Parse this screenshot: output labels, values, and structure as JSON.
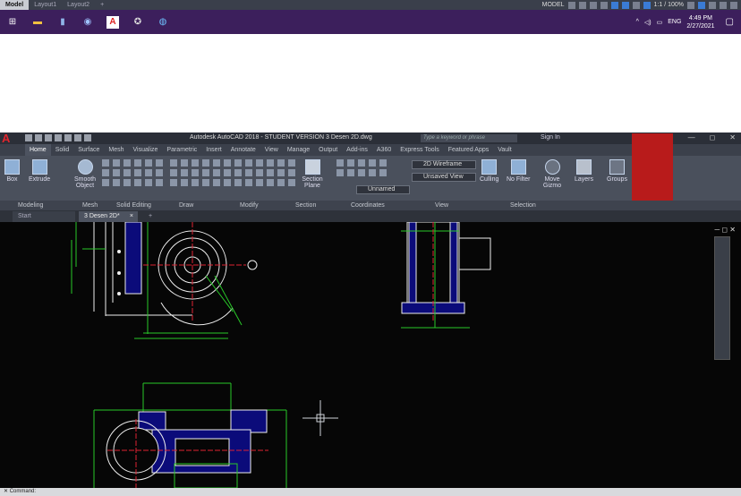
{
  "top_strip": {
    "layout_tabs": [
      "Model",
      "Layout1",
      "Layout2"
    ],
    "add_tab": "+",
    "model_label": "MODEL",
    "scale": "1:1 / 100%"
  },
  "taskbar": {
    "icons": [
      "windows-start-icon",
      "file-explorer-icon",
      "notepad-icon",
      "browser-icon",
      "autocad-icon",
      "app-icon",
      "globe-icon"
    ],
    "language": "ENG",
    "time": "4:49 PM",
    "date": "2/27/2021"
  },
  "window": {
    "app_logo": "A",
    "title": "Autodesk AutoCAD 2018 - STUDENT VERSION    3 Desen 2D.dwg",
    "search_placeholder": "Type a keyword or phrase",
    "sign_in": "Sign In",
    "minimize": "—",
    "restore": "◻",
    "close": "✕"
  },
  "ribbon_tabs": [
    "Home",
    "Solid",
    "Surface",
    "Mesh",
    "Visualize",
    "Parametric",
    "Insert",
    "Annotate",
    "View",
    "Manage",
    "Output",
    "Add-ins",
    "A360",
    "Express Tools",
    "Featured Apps",
    "Vault"
  ],
  "ribbon": {
    "box": "Box",
    "extrude": "Extrude",
    "smooth_object": "Smooth Object",
    "section_plane": "Section Plane",
    "visual_style": "2D Wireframe",
    "view_preset": "Unsaved View",
    "ucs_name": "Unnamed",
    "culling": "Culling",
    "no_filter": "No Filter",
    "move_gizmo": "Move Gizmo",
    "layers": "Layers",
    "groups": "Groups"
  },
  "panel_labels": [
    "Modeling",
    "Mesh",
    "Solid Editing",
    "Draw",
    "Modify",
    "Section",
    "Coordinates",
    "View",
    "Selection"
  ],
  "file_tabs": {
    "start": "Start",
    "active": "3 Desen 2D*",
    "close": "×",
    "add": "+"
  },
  "canvas": {
    "controls": "─ ◻ ✕"
  },
  "command": {
    "prompt": "Command:"
  }
}
